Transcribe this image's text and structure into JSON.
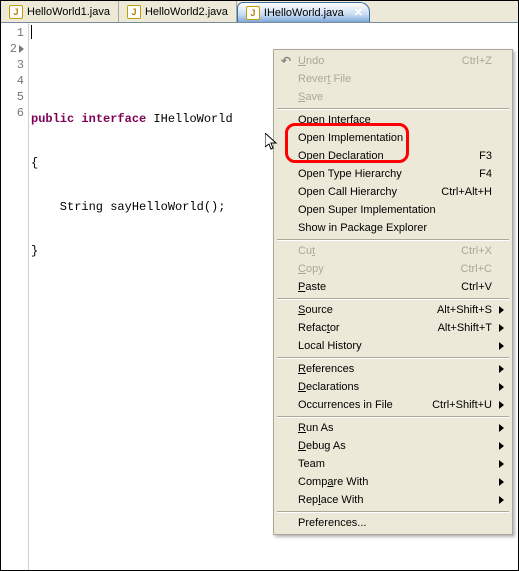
{
  "tabs": {
    "t0": {
      "label": "HelloWorld1.java"
    },
    "t1": {
      "label": "HelloWorld2.java"
    },
    "t2": {
      "label": "IHelloWorld.java",
      "active": true
    }
  },
  "code": {
    "lines": [
      "",
      "public interface IHelloWorld",
      "{",
      "    String sayHelloWorld();",
      "}",
      ""
    ],
    "line_numbers": [
      "1",
      "2",
      "3",
      "4",
      "5",
      "6"
    ]
  },
  "menu": {
    "undo": {
      "label": "Undo",
      "shortcut": "Ctrl+Z",
      "disabled": true
    },
    "revert": {
      "label": "Revert File",
      "disabled": true
    },
    "save": {
      "label": "Save",
      "disabled": true
    },
    "open_interface": {
      "label": "Open Interface"
    },
    "open_implementation": {
      "label": "Open Implementation"
    },
    "open_declaration": {
      "label": "Open Declaration",
      "shortcut": "F3"
    },
    "open_type_hierarchy": {
      "label": "Open Type Hierarchy",
      "shortcut": "F4"
    },
    "open_call_hierarchy": {
      "label": "Open Call Hierarchy",
      "shortcut": "Ctrl+Alt+H"
    },
    "open_super_impl": {
      "label": "Open Super Implementation"
    },
    "show_in_package": {
      "label": "Show in Package Explorer"
    },
    "cut": {
      "label": "Cut",
      "shortcut": "Ctrl+X",
      "disabled": true
    },
    "copy": {
      "label": "Copy",
      "shortcut": "Ctrl+C",
      "disabled": true
    },
    "paste": {
      "label": "Paste",
      "shortcut": "Ctrl+V"
    },
    "source": {
      "label": "Source",
      "shortcut": "Alt+Shift+S",
      "submenu": true
    },
    "refactor": {
      "label": "Refactor",
      "shortcut": "Alt+Shift+T",
      "submenu": true
    },
    "local_history": {
      "label": "Local History",
      "submenu": true
    },
    "references": {
      "label": "References",
      "submenu": true
    },
    "declarations": {
      "label": "Declarations",
      "submenu": true
    },
    "occurrences": {
      "label": "Occurrences in File",
      "shortcut": "Ctrl+Shift+U",
      "submenu": true
    },
    "run_as": {
      "label": "Run As",
      "submenu": true
    },
    "debug_as": {
      "label": "Debug As",
      "submenu": true
    },
    "team": {
      "label": "Team",
      "submenu": true
    },
    "compare": {
      "label": "Compare With",
      "submenu": true
    },
    "replace": {
      "label": "Replace With",
      "submenu": true
    },
    "preferences": {
      "label": "Preferences..."
    }
  }
}
